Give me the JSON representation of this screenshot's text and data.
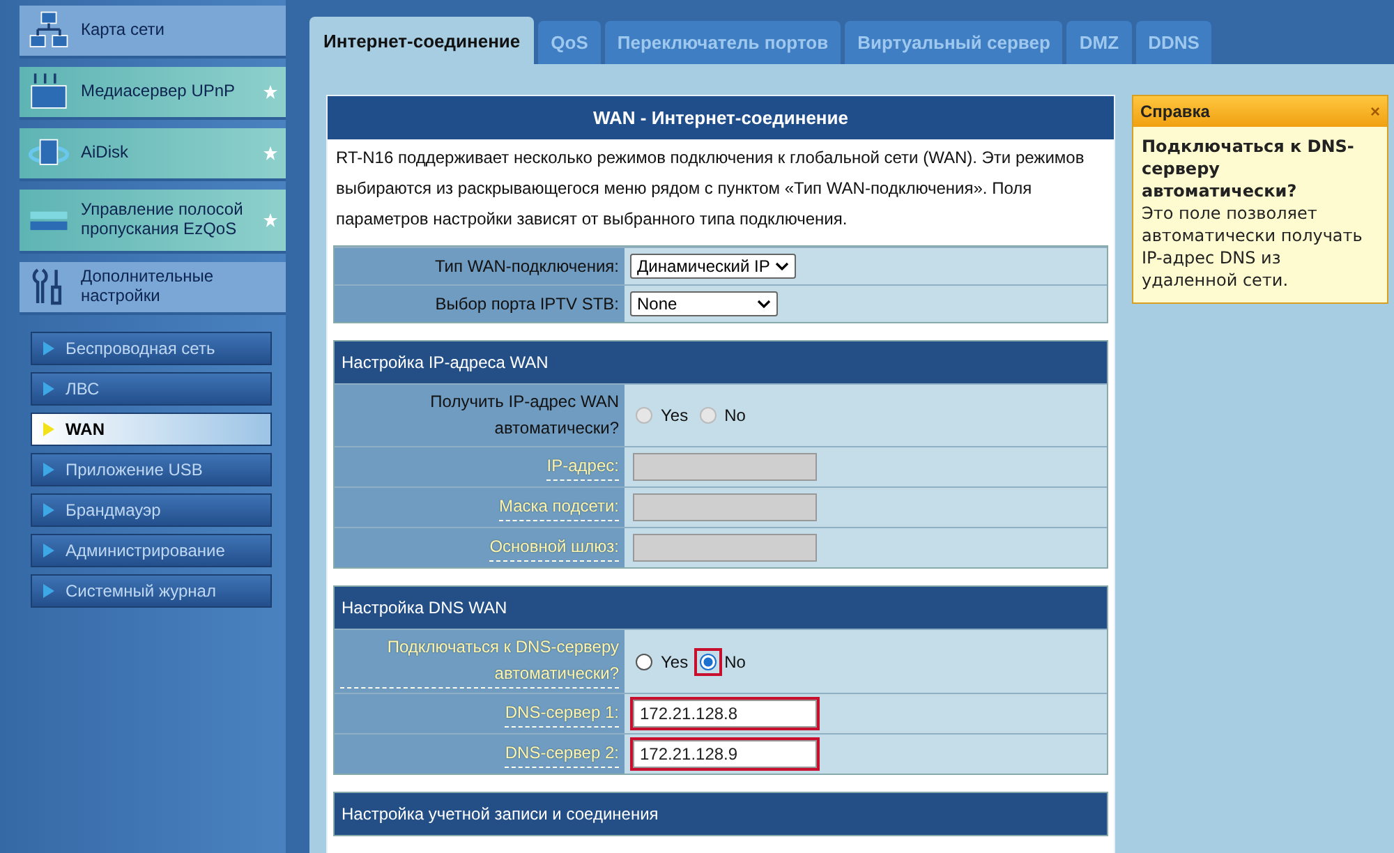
{
  "menu": [
    {
      "label": "Карта сети",
      "kind": "network"
    },
    {
      "label": "Медиасервер UPnP",
      "kind": "media"
    },
    {
      "label": "AiDisk",
      "kind": "disk"
    },
    {
      "label": "Управление полосой пропускания EzQoS",
      "kind": "qos"
    },
    {
      "label": "Дополнительные настройки",
      "kind": "tools"
    }
  ],
  "submenu": [
    {
      "label": "Беспроводная сеть",
      "selected": false
    },
    {
      "label": "ЛВС",
      "selected": false
    },
    {
      "label": "WAN",
      "selected": true
    },
    {
      "label": "Приложение USB",
      "selected": false
    },
    {
      "label": "Брандмауэр",
      "selected": false
    },
    {
      "label": "Администрирование",
      "selected": false
    },
    {
      "label": "Системный журнал",
      "selected": false
    }
  ],
  "tabs": [
    {
      "label": "Интернет-соединение",
      "selected": true
    },
    {
      "label": "QoS",
      "selected": false
    },
    {
      "label": "Переключатель портов",
      "selected": false
    },
    {
      "label": "Виртуальный сервер",
      "selected": false
    },
    {
      "label": "DMZ",
      "selected": false
    },
    {
      "label": "DDNS",
      "selected": false
    }
  ],
  "panel": {
    "title": "WAN - Интернет-соединение",
    "intro": "RT-N16 поддерживает несколько режимов подключения к глобальной сети (WAN). Эти режимов выбираются из раскрывающегося меню рядом с пунктом «Тип WAN-подключения». Поля параметров настройки зависят от выбранного типа подключения.",
    "sections": [
      {
        "rows": [
          {
            "kind": "select",
            "label": "Тип WAN-подключения:",
            "link": false,
            "value": "Динамический IP"
          },
          {
            "kind": "select",
            "label": "Выбор порта IPTV STB:",
            "link": false,
            "value": "None"
          }
        ]
      },
      {
        "title": "Настройка IP-адреса WAN",
        "rows": [
          {
            "kind": "radio",
            "label": "Получить IP-адрес WAN автоматически?",
            "link": false,
            "disabled": true,
            "options": [
              {
                "label": "Yes",
                "selected": false,
                "highlighted": false
              },
              {
                "label": "No",
                "selected": false,
                "highlighted": false
              }
            ]
          },
          {
            "kind": "input",
            "label": "IP-адрес:",
            "link": true,
            "disabled": true,
            "highlighted": false
          },
          {
            "kind": "input",
            "label": "Маска подсети:",
            "link": true,
            "disabled": true,
            "highlighted": false
          },
          {
            "kind": "input",
            "label": "Основной шлюз:",
            "link": true,
            "disabled": true,
            "highlighted": false
          }
        ]
      },
      {
        "title": "Настройка DNS WAN",
        "rows": [
          {
            "kind": "radio",
            "label": "Подключаться к DNS-серверу автоматически?",
            "link": true,
            "disabled": false,
            "options": [
              {
                "label": "Yes",
                "selected": false,
                "highlighted": false
              },
              {
                "label": "No",
                "selected": true,
                "highlighted": true
              }
            ]
          },
          {
            "kind": "input",
            "label": "DNS-сервер 1:",
            "link": true,
            "disabled": false,
            "highlighted": true,
            "value": "172.21.128.8"
          },
          {
            "kind": "input",
            "label": "DNS-сервер 2:",
            "link": true,
            "disabled": false,
            "highlighted": true,
            "value": "172.21.128.9"
          }
        ]
      },
      {
        "title": "Настройка учетной записи и соединения"
      }
    ]
  },
  "help": {
    "title": "Справка",
    "close": "×",
    "heading": "Подключаться к DNS-серверу автоматически?",
    "text": "Это поле позволяет автоматически получать IP-адрес DNS из удаленной сети."
  }
}
